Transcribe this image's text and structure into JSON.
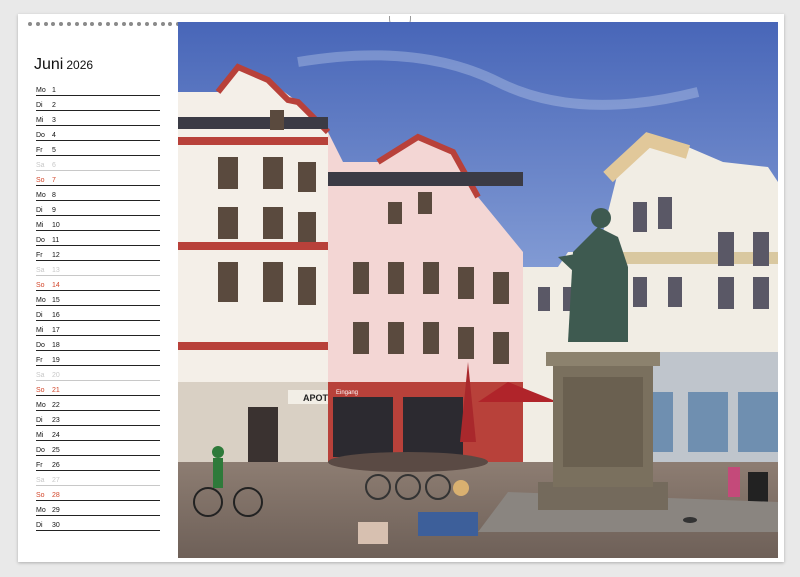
{
  "calendar": {
    "month": "Juni",
    "year": "2026",
    "days": [
      {
        "wd": "Mo",
        "d": "1",
        "type": "weekday"
      },
      {
        "wd": "Di",
        "d": "2",
        "type": "weekday"
      },
      {
        "wd": "Mi",
        "d": "3",
        "type": "weekday"
      },
      {
        "wd": "Do",
        "d": "4",
        "type": "weekday"
      },
      {
        "wd": "Fr",
        "d": "5",
        "type": "weekday"
      },
      {
        "wd": "Sa",
        "d": "6",
        "type": "sat"
      },
      {
        "wd": "So",
        "d": "7",
        "type": "sun"
      },
      {
        "wd": "Mo",
        "d": "8",
        "type": "weekday"
      },
      {
        "wd": "Di",
        "d": "9",
        "type": "weekday"
      },
      {
        "wd": "Mi",
        "d": "10",
        "type": "weekday"
      },
      {
        "wd": "Do",
        "d": "11",
        "type": "weekday"
      },
      {
        "wd": "Fr",
        "d": "12",
        "type": "weekday"
      },
      {
        "wd": "Sa",
        "d": "13",
        "type": "sat"
      },
      {
        "wd": "So",
        "d": "14",
        "type": "sun"
      },
      {
        "wd": "Mo",
        "d": "15",
        "type": "weekday"
      },
      {
        "wd": "Di",
        "d": "16",
        "type": "weekday"
      },
      {
        "wd": "Mi",
        "d": "17",
        "type": "weekday"
      },
      {
        "wd": "Do",
        "d": "18",
        "type": "weekday"
      },
      {
        "wd": "Fr",
        "d": "19",
        "type": "weekday"
      },
      {
        "wd": "Sa",
        "d": "20",
        "type": "sat"
      },
      {
        "wd": "So",
        "d": "21",
        "type": "sun"
      },
      {
        "wd": "Mo",
        "d": "22",
        "type": "weekday"
      },
      {
        "wd": "Di",
        "d": "23",
        "type": "weekday"
      },
      {
        "wd": "Mi",
        "d": "24",
        "type": "weekday"
      },
      {
        "wd": "Do",
        "d": "25",
        "type": "weekday"
      },
      {
        "wd": "Fr",
        "d": "26",
        "type": "weekday"
      },
      {
        "wd": "Sa",
        "d": "27",
        "type": "sat"
      },
      {
        "wd": "So",
        "d": "28",
        "type": "sun"
      },
      {
        "wd": "Mo",
        "d": "29",
        "type": "weekday"
      },
      {
        "wd": "Di",
        "d": "30",
        "type": "weekday"
      }
    ]
  },
  "photo": {
    "signs": {
      "apotheke": "APOTHEKE",
      "entrance": "Eingang"
    }
  },
  "colors": {
    "sunday": "#d2462a",
    "saturday": "#c8c8c8",
    "sky": "#4f6fc0",
    "facade_red": "#b8413a"
  }
}
